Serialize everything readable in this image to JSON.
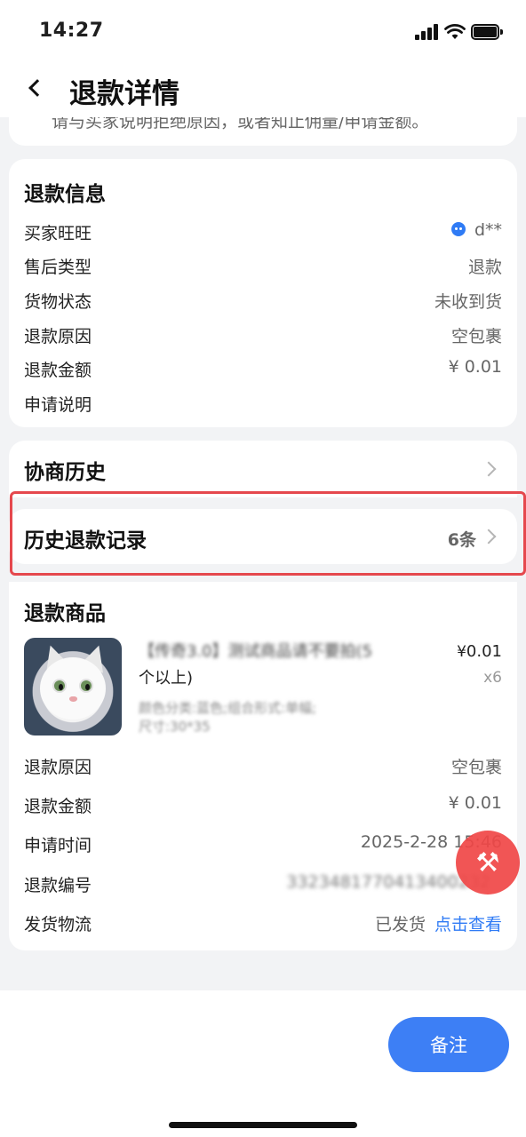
{
  "status_bar": {
    "time": "14:27"
  },
  "header": {
    "title": "退款详情"
  },
  "top_notice": {
    "text": "请与买家说明拒绝原因，或者知止佣量/申请金额。"
  },
  "refund_info": {
    "title": "退款信息",
    "rows": [
      {
        "label": "买家旺旺",
        "value": "d**"
      },
      {
        "label": "售后类型",
        "value": "退款"
      },
      {
        "label": "货物状态",
        "value": "未收到货"
      },
      {
        "label": "退款原因",
        "value": "空包裹"
      },
      {
        "label": "退款金额",
        "value": "¥ 0.01"
      },
      {
        "label": "申请说明",
        "value": ""
      }
    ]
  },
  "negotiation_history": {
    "title": "协商历史"
  },
  "refund_records": {
    "title": "历史退款记录",
    "count": "6条"
  },
  "refund_goods": {
    "title": "退款商品",
    "product": {
      "name_line1": "【传奇3.0】测试商品请不要拍(5",
      "name_line2": "个以上)",
      "spec_line1": "颜色分类:蓝色;组合形式:单幅;",
      "spec_line2": "尺寸:30*35",
      "price_symbol": "¥",
      "price": "0.01",
      "quantity": "x6"
    },
    "rows": [
      {
        "label": "退款原因",
        "value": "空包裹"
      },
      {
        "label": "退款金额",
        "value": "¥ 0.01"
      },
      {
        "label": "申请时间",
        "value": "2025-2-28 15:46"
      },
      {
        "label": "退款编号",
        "value": "3323481770413400232"
      }
    ],
    "logistics": {
      "label": "发货物流",
      "status": "已发货",
      "link": "点击查看"
    }
  },
  "actions": {
    "note_label": "备注"
  },
  "colors": {
    "accent": "#3d7ff5",
    "highlight": "#e5484d",
    "link": "#2f7bf5",
    "background": "#f2f3f5"
  },
  "icons": [
    "back-arrow-icon",
    "signal-icon",
    "wifi-icon",
    "battery-icon",
    "wangwang-icon",
    "chevron-right-icon",
    "tool-icon",
    "copy-icon"
  ]
}
